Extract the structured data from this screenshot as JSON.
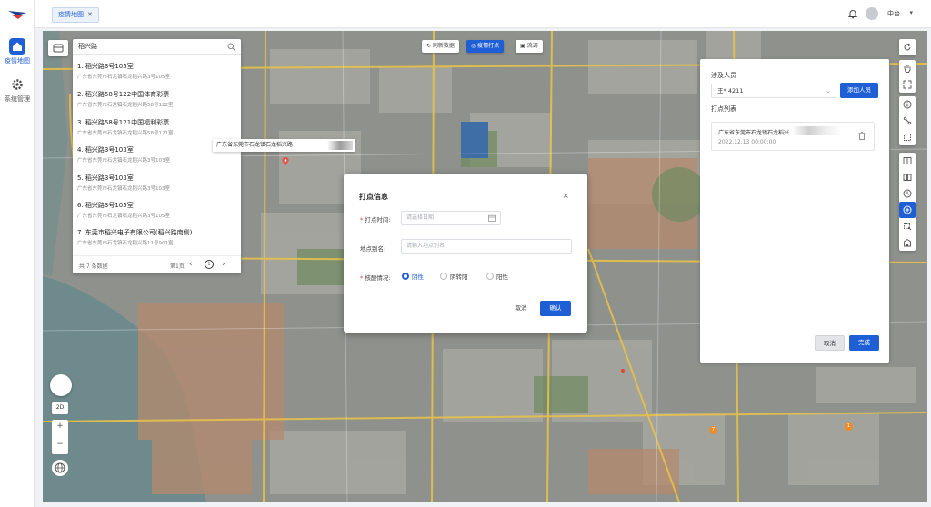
{
  "nav": {
    "items": [
      {
        "label": "疫情地图",
        "icon": "home-icon",
        "active": true
      },
      {
        "label": "系统管理",
        "icon": "gear-icon",
        "active": false
      }
    ]
  },
  "topbar": {
    "tab_label": "疫情地图",
    "tab_close": "✕",
    "user_name": "中台",
    "user_caret": "▾"
  },
  "search": {
    "query": "稻兴路",
    "results": [
      {
        "title": "1. 稻兴路3号105室",
        "sub": "广东省东莞市石龙镇石龙稻兴路3号105室"
      },
      {
        "title": "2. 稻兴路58号122中国体育彩票",
        "sub": "广东省东莞市石龙镇石龙稻兴路58号122室"
      },
      {
        "title": "3. 稻兴路58号121中国福利彩票",
        "sub": "广东省东莞市石龙镇石龙稻兴路58号121室"
      },
      {
        "title": "4. 稻兴路3号103室",
        "sub": "广东省东莞市石龙镇石龙稻兴路3号103室"
      },
      {
        "title": "5. 稻兴路3号103室",
        "sub": "广东省东莞市石龙镇石龙稻兴路3号103室"
      },
      {
        "title": "6. 稻兴路3号105室",
        "sub": "广东省东莞市石龙镇石龙稻兴路3号105室"
      },
      {
        "title": "7. 东莞市稻兴电子有限公司(稻兴路南侧)",
        "sub": "广东省东莞市石龙镇石龙稻兴路11号901室"
      }
    ],
    "pager": {
      "total": "共 7 条数据",
      "page": "第1页",
      "prev": "‹",
      "current": "1",
      "next": "›"
    }
  },
  "map_tools": [
    {
      "label": "↻ 刷新数据",
      "active": false
    },
    {
      "label": "◎ 疫情打点",
      "active": true
    },
    {
      "label": "▣ 流调",
      "active": false
    }
  ],
  "addr_popup": "广东省东莞市石龙镇石龙稻兴路",
  "dialog": {
    "title": "打点信息",
    "close": "×",
    "fields": [
      {
        "label": "打点时间:",
        "required": true,
        "placeholder": "请选择日期"
      },
      {
        "label": "地点别名:",
        "required": false,
        "placeholder": "请输入地点别名"
      }
    ],
    "infection_label": "核酸情况:",
    "radios": [
      {
        "label": "阴性",
        "checked": true
      },
      {
        "label": "阴转阳",
        "checked": false
      },
      {
        "label": "阳性",
        "checked": false
      }
    ],
    "cancel": "取消",
    "confirm": "确认"
  },
  "rpanel": {
    "person_label": "涉及人员",
    "person_value": "王*        4211",
    "caret": "⌄",
    "add_button": "添加人员",
    "list_label": "打点列表",
    "items": [
      {
        "address": "广东省东莞市石龙镇石龙稻兴",
        "date": "2022.12.13 00:00:00"
      }
    ],
    "cancel": "取消",
    "done": "完成"
  },
  "map_controls": {
    "mode_2d": "2D",
    "zoom_in": "+",
    "zoom_out": "−"
  },
  "pins": [
    "7",
    "1"
  ],
  "colors": {
    "primary": "#1f5fd6",
    "map_road": "#e6c14a",
    "pin": "#f08a24",
    "required": "#e23b3b"
  }
}
